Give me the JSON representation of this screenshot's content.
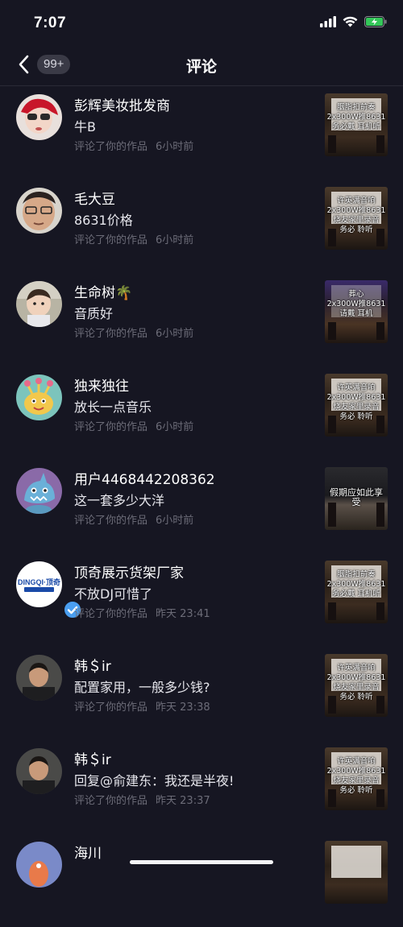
{
  "status_bar": {
    "time": "7:07",
    "battery_color": "#34c759"
  },
  "nav": {
    "title": "评论",
    "badge": "99+"
  },
  "comments": [
    {
      "name": "彭辉美妆批发商",
      "text": "牛B",
      "action": "评论了你的作品",
      "time": "6小时前",
      "thumb_caption": "胭脂扣前奏\n2x300W推8631\n务必戴   耳机听"
    },
    {
      "name": "毛大豆",
      "text": "8631价格",
      "action": "评论了你的作品",
      "time": "6小时前",
      "thumb_caption": "许英满音响\n2x300W推8631\n烧友家里录音\n务必  聆听"
    },
    {
      "name": "生命树🌴",
      "text": "音质好",
      "action": "评论了你的作品",
      "time": "6小时前",
      "thumb_caption": "葬心\n2x300W推8631\n请戴   耳机"
    },
    {
      "name": "独来独往",
      "text": "放长一点音乐",
      "action": "评论了你的作品",
      "time": "6小时前",
      "thumb_caption": "许英满音响\n2x300W推8631\n烧友家里录音\n务必  聆听"
    },
    {
      "name": "用户4468442208362",
      "text": "这一套多少大洋",
      "action": "评论了你的作品",
      "time": "6小时前",
      "thumb_caption": "假期应如此享受"
    },
    {
      "name": "顶奇展示货架厂家",
      "text": "不放DJ可惜了",
      "action": "评论了你的作品",
      "time": "昨天 23:41",
      "thumb_caption": "胭脂扣前奏\n2x300W推8631\n务必戴   耳机听"
    },
    {
      "name": "韩＄ir",
      "text": "配置家用，一般多少钱?",
      "action": "评论了你的作品",
      "time": "昨天 23:38",
      "thumb_caption": "许英满音响\n2x300W推8631\n烧友家里录音\n务必  聆听"
    },
    {
      "name": "韩＄ir",
      "text": "回复@俞建东：我还是半夜!",
      "action": "评论了你的作品",
      "time": "昨天 23:37",
      "thumb_caption": "许英满音响\n2x300W推8631\n烧友家里录音\n务必  聆听"
    },
    {
      "name": "海川",
      "text": "",
      "action": "",
      "time": "",
      "thumb_caption": ""
    }
  ],
  "dingqi_logo": "DINGQI·顶奇"
}
